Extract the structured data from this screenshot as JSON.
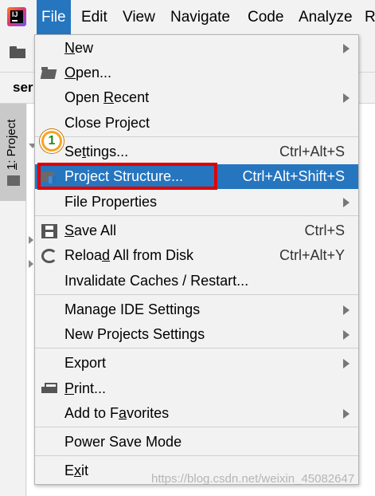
{
  "menubar": {
    "items": [
      {
        "label": "File",
        "mnemonic": "F",
        "active": true
      },
      {
        "label": "Edit",
        "mnemonic": "E"
      },
      {
        "label": "View",
        "mnemonic": "V"
      },
      {
        "label": "Navigate",
        "mnemonic": "N"
      },
      {
        "label": "Code",
        "mnemonic": "C"
      },
      {
        "label": "Analyze",
        "mnemonic": "z"
      },
      {
        "label": "R",
        "mnemonic": "R"
      }
    ]
  },
  "background": {
    "tab_text": "ser",
    "side_tab_number": "1",
    "side_tab_label": ": Project"
  },
  "file_menu": {
    "items": [
      {
        "id": "new",
        "pre": "",
        "mn": "N",
        "post": "ew",
        "shortcut": "",
        "submenu": true,
        "icon": ""
      },
      {
        "id": "open",
        "pre": "",
        "mn": "O",
        "post": "pen...",
        "shortcut": "",
        "submenu": false,
        "icon": "folder-icon"
      },
      {
        "id": "open-recent",
        "pre": "Open ",
        "mn": "R",
        "post": "ecent",
        "shortcut": "",
        "submenu": true,
        "icon": ""
      },
      {
        "id": "close-project",
        "pre": "Close Pro",
        "mn": "j",
        "post": "ect",
        "shortcut": "",
        "submenu": false,
        "icon": ""
      },
      {
        "id": "settings",
        "pre": "Se",
        "mn": "t",
        "post": "tings...",
        "shortcut": "Ctrl+Alt+S",
        "submenu": false,
        "icon": ""
      },
      {
        "id": "project-structure",
        "pre": "Project Structure...",
        "mn": "",
        "post": "",
        "shortcut": "Ctrl+Alt+Shift+S",
        "submenu": false,
        "icon": "project-structure-icon",
        "selected": true
      },
      {
        "id": "file-properties",
        "pre": "File Properties",
        "mn": "",
        "post": "",
        "shortcut": "",
        "submenu": true,
        "icon": ""
      },
      {
        "id": "save-all",
        "pre": "",
        "mn": "S",
        "post": "ave All",
        "shortcut": "Ctrl+S",
        "submenu": false,
        "icon": "save-icon"
      },
      {
        "id": "reload-all",
        "pre": "Reloa",
        "mn": "d",
        "post": " All from Disk",
        "shortcut": "Ctrl+Alt+Y",
        "submenu": false,
        "icon": "reload-icon"
      },
      {
        "id": "invalidate-caches",
        "pre": "Invalidate Caches / Restart...",
        "mn": "",
        "post": "",
        "shortcut": "",
        "submenu": false,
        "icon": ""
      },
      {
        "id": "manage-ide-settings",
        "pre": "Manage IDE Settings",
        "mn": "",
        "post": "",
        "shortcut": "",
        "submenu": true,
        "icon": ""
      },
      {
        "id": "new-projects-settings",
        "pre": "New Projects Settings",
        "mn": "",
        "post": "",
        "shortcut": "",
        "submenu": true,
        "icon": ""
      },
      {
        "id": "export",
        "pre": "Export",
        "mn": "",
        "post": "",
        "shortcut": "",
        "submenu": true,
        "icon": ""
      },
      {
        "id": "print",
        "pre": "",
        "mn": "P",
        "post": "rint...",
        "shortcut": "",
        "submenu": false,
        "icon": "print-icon"
      },
      {
        "id": "add-to-favorites",
        "pre": "Add to F",
        "mn": "a",
        "post": "vorites",
        "shortcut": "",
        "submenu": true,
        "icon": ""
      },
      {
        "id": "power-save-mode",
        "pre": "Power Save Mode",
        "mn": "",
        "post": "",
        "shortcut": "",
        "submenu": false,
        "icon": ""
      },
      {
        "id": "exit",
        "pre": "E",
        "mn": "x",
        "post": "it",
        "shortcut": "",
        "submenu": false,
        "icon": ""
      }
    ]
  },
  "annotation": {
    "badge_number": "1"
  },
  "watermark": "https://blog.csdn.net/weixin_45082647",
  "colors": {
    "selection": "#2675bf",
    "highlight_border": "#e00000",
    "badge": "#f5a524"
  }
}
